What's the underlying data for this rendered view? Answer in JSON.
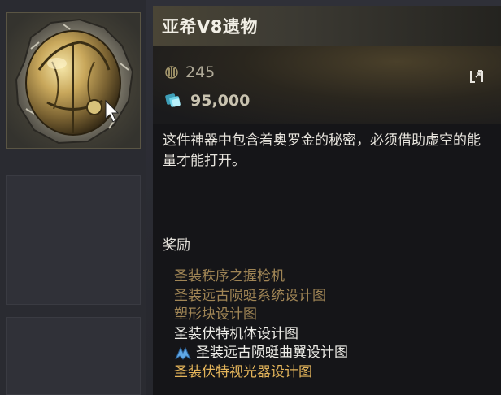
{
  "item": {
    "name": "亚希V8遗物",
    "power": "245",
    "glimmer_cost": "95,000",
    "description": "这件神器中包含着奥罗金的秘密，必须借助虚空的能量才能打开。"
  },
  "icons": {
    "item": "ornate-golden-egg-relic-icon",
    "power": "power-level-icon",
    "currency": "glimmer-currency-icon",
    "swap": "swap-compare-icon",
    "reward_marker": "ship-emblem-icon"
  },
  "rewards": {
    "heading": "奖励",
    "items": [
      {
        "label": "圣装秩序之握枪机",
        "tone": "muted",
        "icon": ""
      },
      {
        "label": "圣装远古陨蜓系统设计图",
        "tone": "muted",
        "icon": ""
      },
      {
        "label": "塑形块设计图",
        "tone": "muted",
        "icon": ""
      },
      {
        "label": "圣装伏特机体设计图",
        "tone": "white",
        "icon": ""
      },
      {
        "label": "圣装远古陨蜓曲翼设计图",
        "tone": "white",
        "icon": "ship-emblem-icon"
      },
      {
        "label": "圣装伏特视光器设计图",
        "tone": "bright",
        "icon": ""
      }
    ]
  },
  "colors": {
    "header_gold": "#4a4536",
    "reward_muted": "#a08555",
    "reward_white": "#ecebe6",
    "reward_bright": "#e3b45a",
    "glimmer_blue": "#6fd3e8"
  }
}
